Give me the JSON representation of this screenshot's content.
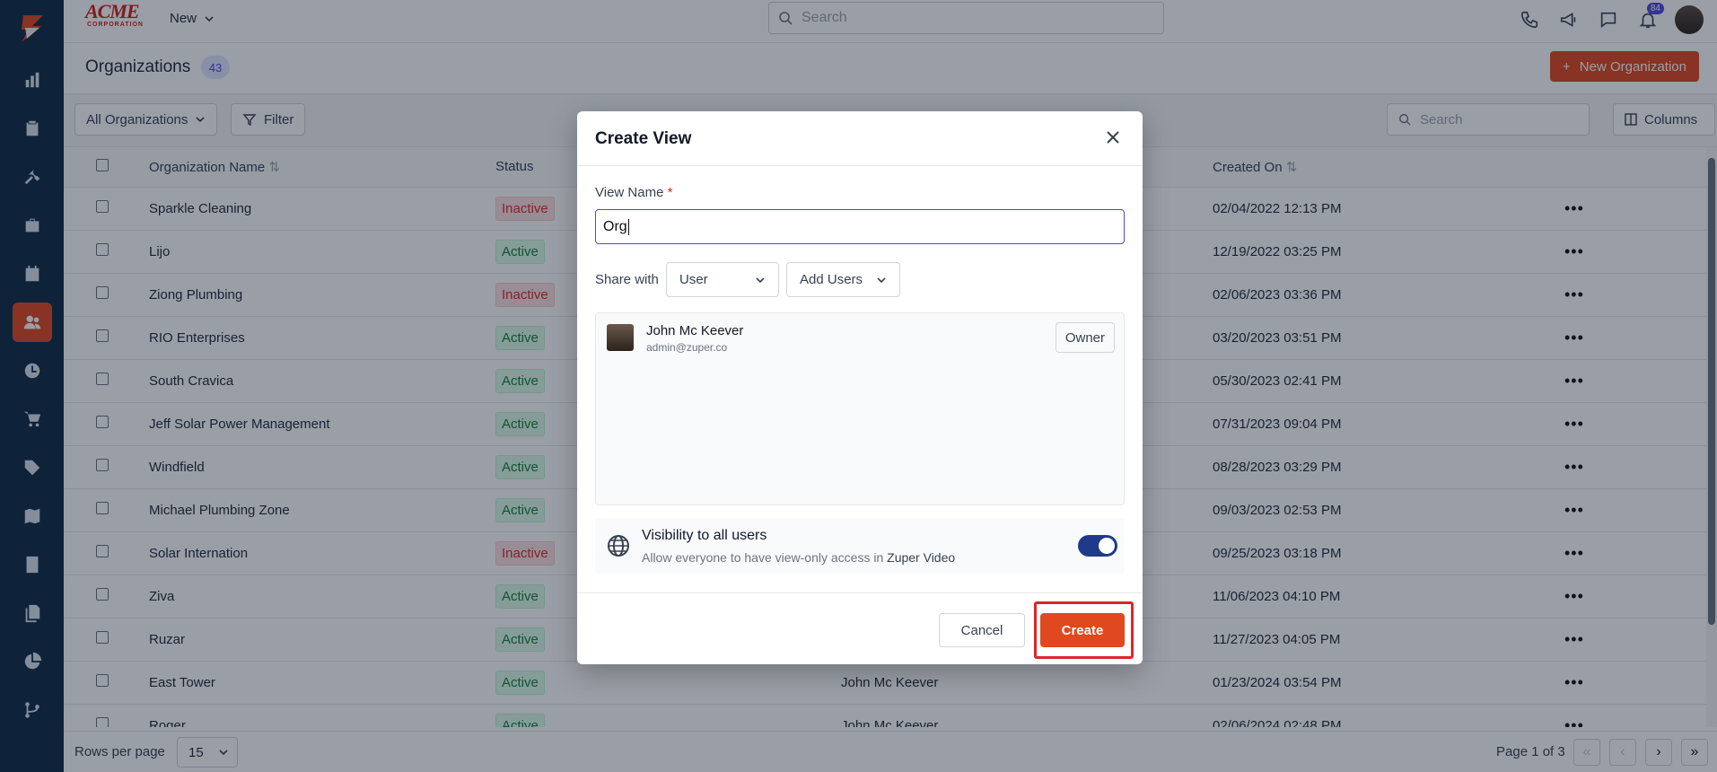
{
  "brand": {
    "name": "ACME",
    "sub": "CORPORATION"
  },
  "topbar": {
    "new_label": "New",
    "search_placeholder": "Search",
    "notification_count": "84"
  },
  "page": {
    "title": "Organizations",
    "count": "43",
    "new_button": "New Organization"
  },
  "filters": {
    "view_select": "All Organizations",
    "filter_button": "Filter",
    "search_placeholder": "Search",
    "columns_button": "Columns"
  },
  "table": {
    "headers": {
      "name": "Organization Name",
      "status": "Status",
      "created_on": "Created On"
    },
    "rows": [
      {
        "name": "Sparkle Cleaning",
        "status": "Inactive",
        "owner": "",
        "created": "02/04/2022 12:13 PM"
      },
      {
        "name": "Lijo",
        "status": "Active",
        "owner": "",
        "created": "12/19/2022 03:25 PM"
      },
      {
        "name": "Ziong Plumbing",
        "status": "Inactive",
        "owner": "",
        "created": "02/06/2023 03:36 PM"
      },
      {
        "name": "RIO Enterprises",
        "status": "Active",
        "owner": "",
        "created": "03/20/2023 03:51 PM"
      },
      {
        "name": "South Cravica",
        "status": "Active",
        "owner": "",
        "created": "05/30/2023 02:41 PM"
      },
      {
        "name": "Jeff Solar Power Management",
        "status": "Active",
        "owner": "",
        "created": "07/31/2023 09:04 PM"
      },
      {
        "name": "Windfield",
        "status": "Active",
        "owner": "",
        "created": "08/28/2023 03:29 PM"
      },
      {
        "name": "Michael Plumbing Zone",
        "status": "Active",
        "owner": "",
        "created": "09/03/2023 02:53 PM"
      },
      {
        "name": "Solar Internation",
        "status": "Inactive",
        "owner": "",
        "created": "09/25/2023 03:18 PM"
      },
      {
        "name": "Ziva",
        "status": "Active",
        "owner": "",
        "created": "11/06/2023 04:10 PM"
      },
      {
        "name": "Ruzar",
        "status": "Active",
        "owner": "",
        "created": "11/27/2023 04:05 PM"
      },
      {
        "name": "East Tower",
        "status": "Active",
        "owner": "John Mc Keever",
        "created": "01/23/2024 03:54 PM"
      },
      {
        "name": "Roger",
        "status": "Active",
        "owner": "John Mc Keever",
        "created": "02/06/2024 02:48 PM"
      }
    ]
  },
  "footer": {
    "rows_per_page_label": "Rows per page",
    "rows_per_page_value": "15",
    "page_info": "Page 1 of 3"
  },
  "modal": {
    "title": "Create View",
    "view_name_label": "View Name",
    "required_mark": "*",
    "view_name_value": "Org",
    "share_label": "Share with",
    "share_type": "User",
    "add_users": "Add Users",
    "user": {
      "name": "John Mc Keever",
      "email": "admin@zuper.co",
      "role": "Owner"
    },
    "visibility_title": "Visibility to all users",
    "visibility_sub": "Allow everyone to have view-only access in",
    "visibility_app": "Zuper Video",
    "visibility_on": true,
    "cancel": "Cancel",
    "create": "Create"
  },
  "colors": {
    "accent": "#e0481f",
    "sidebar": "#0f2b46",
    "toggle": "#1e3a8a",
    "highlight": "#dc2626"
  }
}
